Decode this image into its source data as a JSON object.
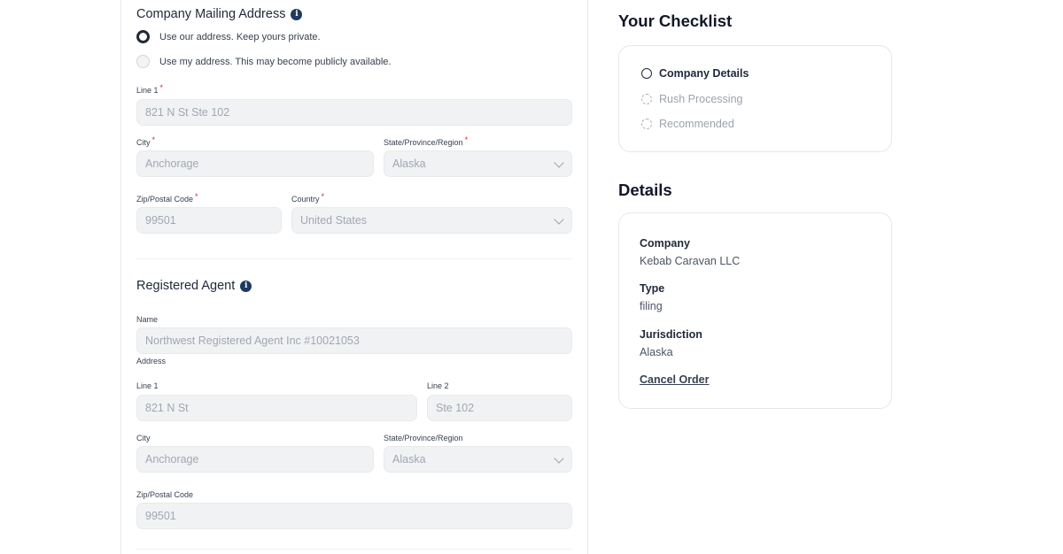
{
  "mailing": {
    "title": "Company Mailing Address",
    "options": [
      {
        "label": "Use our address. Keep yours private.",
        "selected": true
      },
      {
        "label": "Use my address. This may become publicly available.",
        "selected": false
      }
    ],
    "line1_label": "Line 1",
    "line1_value": "821 N St Ste 102",
    "city_label": "City",
    "city_value": "Anchorage",
    "state_label": "State/Province/Region",
    "state_value": "Alaska",
    "zip_label": "Zip/Postal Code",
    "zip_value": "99501",
    "country_label": "Country",
    "country_value": "United States",
    "required_mark": "*"
  },
  "agent": {
    "title": "Registered Agent",
    "name_label": "Name",
    "name_value": "Northwest Registered Agent Inc #10021053",
    "address_label": "Address",
    "line1_label": "Line 1",
    "line1_value": "821 N St",
    "line2_label": "Line 2",
    "line2_value": "Ste 102",
    "city_label": "City",
    "city_value": "Anchorage",
    "state_label": "State/Province/Region",
    "state_value": "Alaska",
    "zip_label": "Zip/Postal Code",
    "zip_value": "99501"
  },
  "checklist": {
    "title": "Your Checklist",
    "items": [
      {
        "label": "Company Details",
        "state": "active"
      },
      {
        "label": "Rush Processing",
        "state": "pending"
      },
      {
        "label": "Recommended",
        "state": "pending"
      }
    ]
  },
  "details": {
    "title": "Details",
    "company_label": "Company",
    "company_value": "Kebab Caravan LLC",
    "type_label": "Type",
    "type_value": "filing",
    "jurisdiction_label": "Jurisdiction",
    "jurisdiction_value": "Alaska",
    "cancel_label": "Cancel Order"
  },
  "icons": {
    "info": "info-icon",
    "chevron": "chevron-down-icon",
    "checklist_active": "circle-outline-icon",
    "checklist_pending": "dashed-circle-icon"
  },
  "colors": {
    "primary_dark": "#1e293b",
    "required": "#dc2626",
    "field_bg": "#f1f2f4"
  }
}
